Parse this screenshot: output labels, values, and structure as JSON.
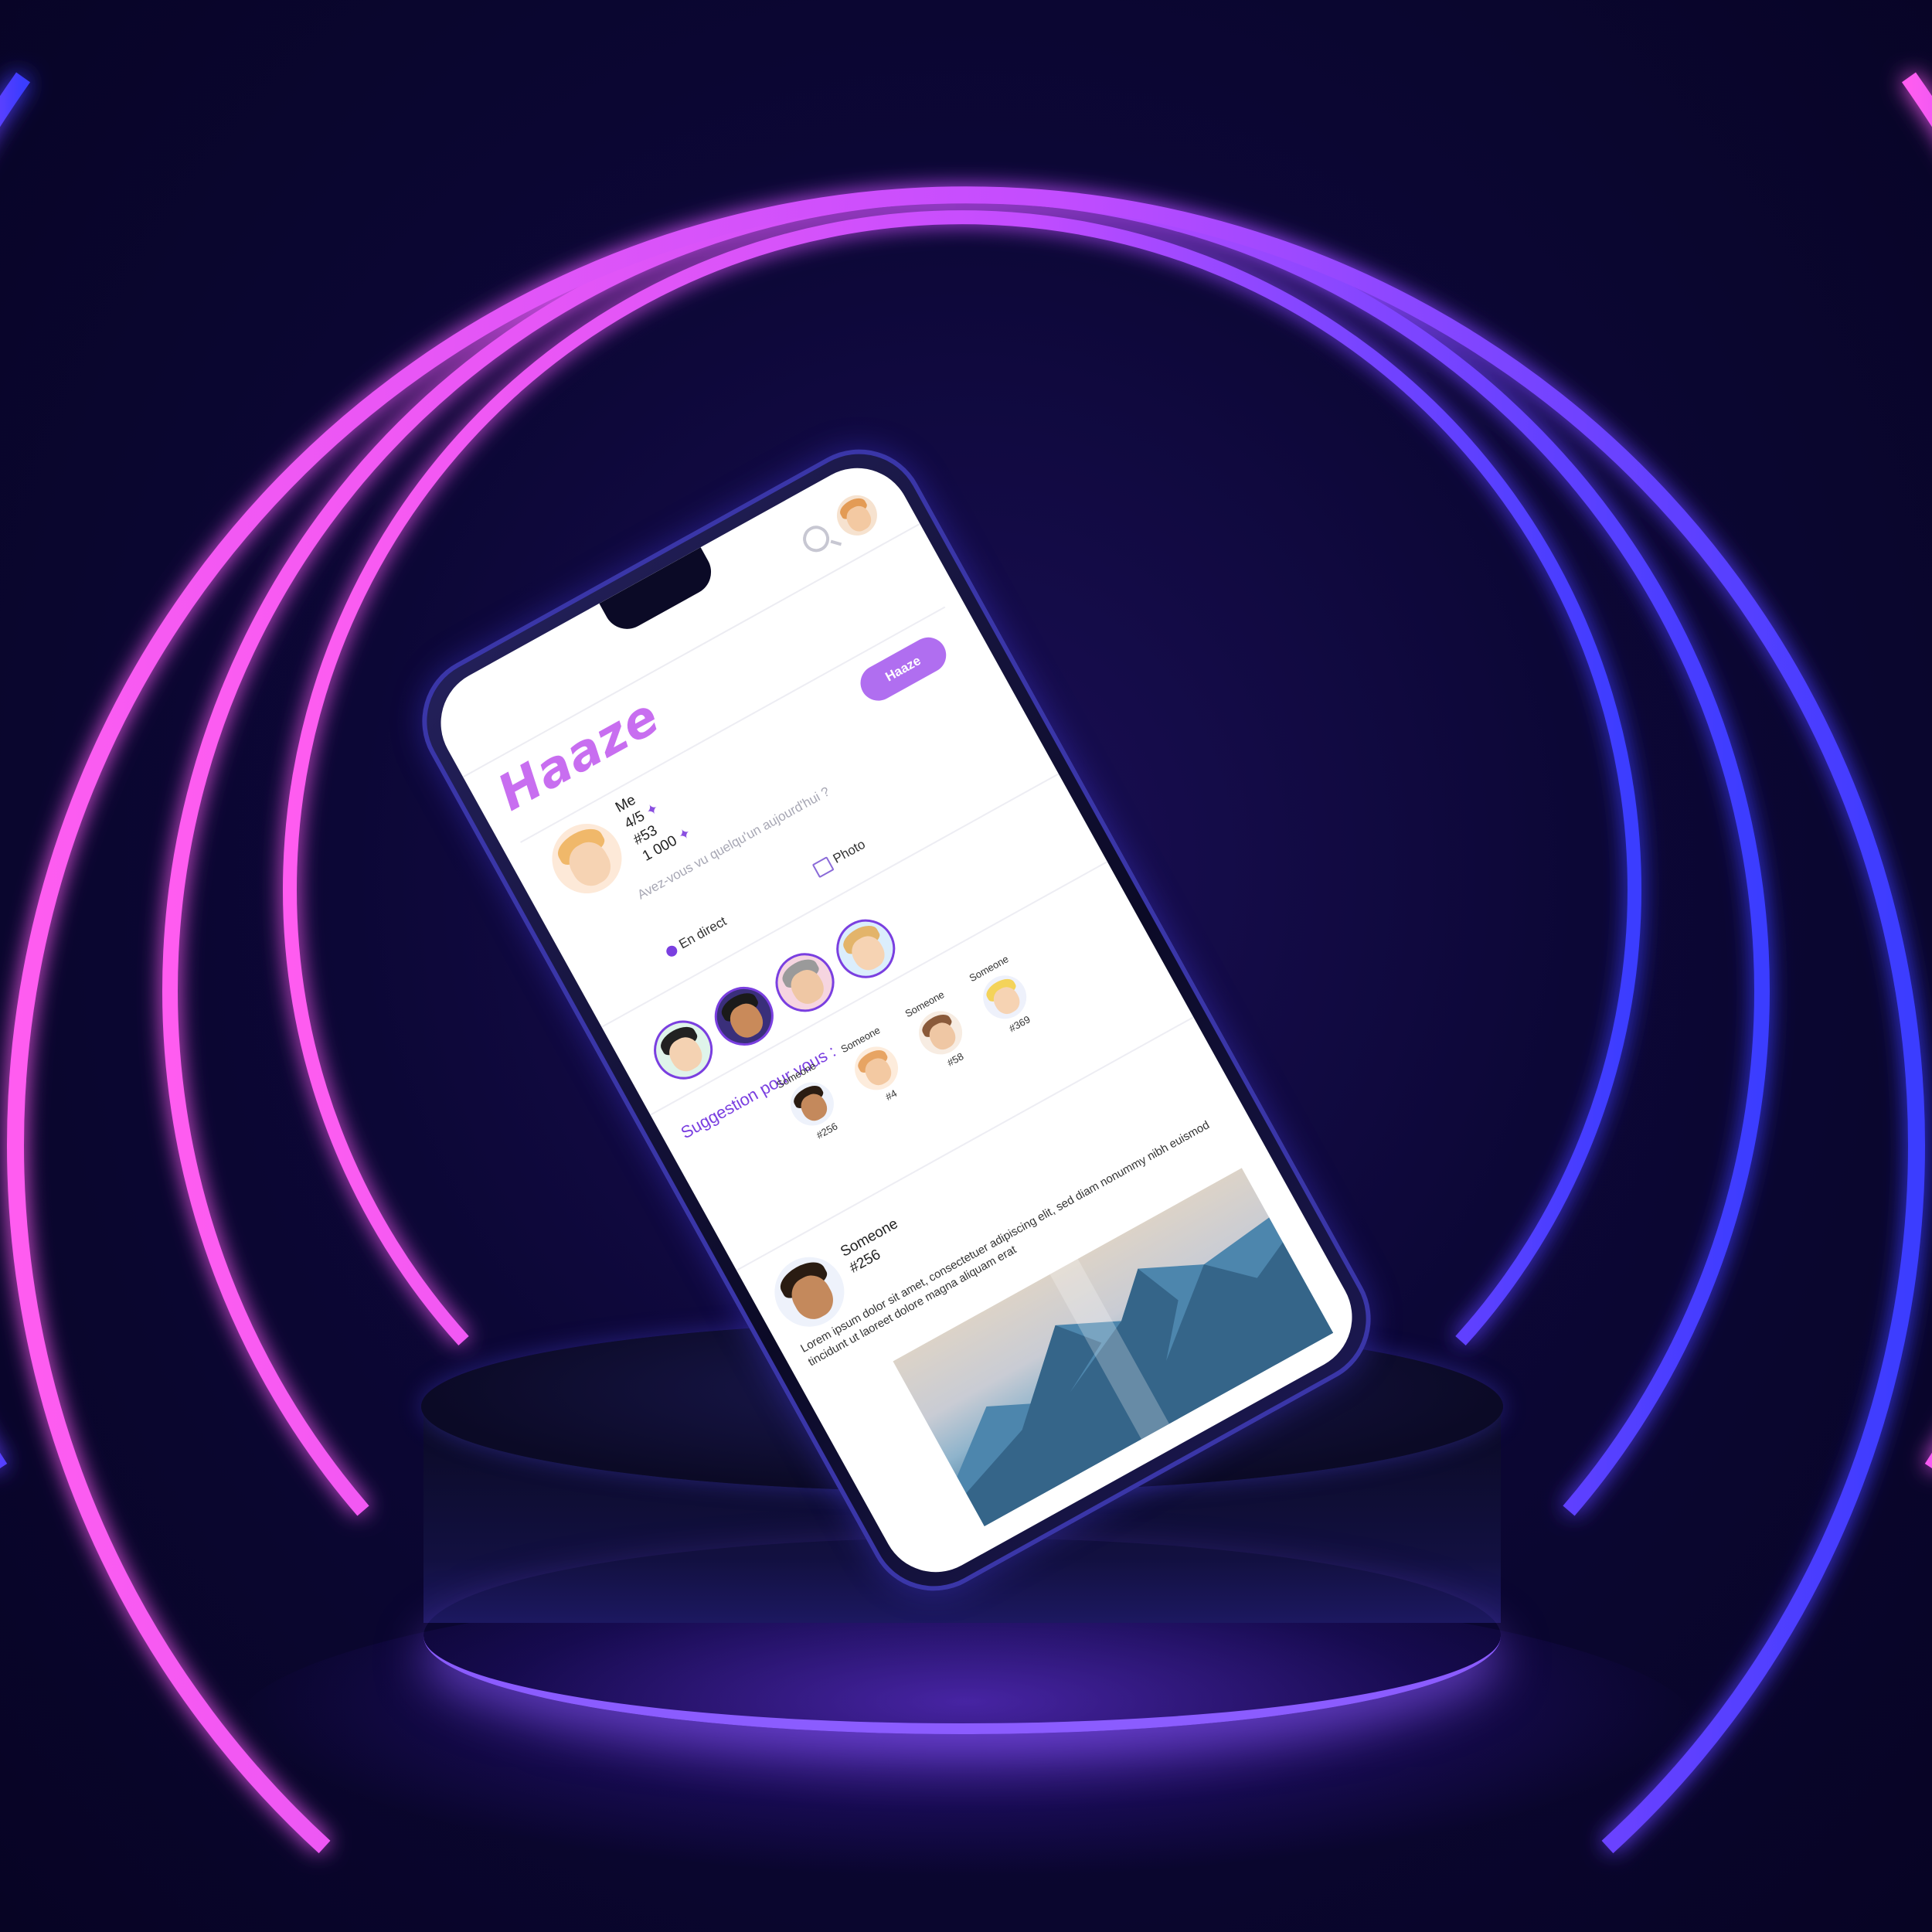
{
  "scene": {
    "ring_colors": [
      "#ff5cf0",
      "#c24dff",
      "#6a4bff",
      "#3a3cff"
    ],
    "background_color": "#0c0736",
    "pedestal_glow_color": "#8b5cff"
  },
  "app": {
    "logo": "Haaze",
    "composer": {
      "user_name": "Me",
      "stat_rating": "4/5",
      "stat_rank": "#53",
      "stat_followers": "1 000",
      "placeholder": "Avez-vous vu quelqu'un aujourd'hui ?",
      "post_button": "Haaze",
      "live_label": "En direct",
      "photo_label": "Photo"
    },
    "suggestions": {
      "title": "Suggestion pour vous :",
      "people": [
        {
          "name": "Someone",
          "rank": "#256"
        },
        {
          "name": "Someone",
          "rank": "#4"
        },
        {
          "name": "Someone",
          "rank": "#58"
        },
        {
          "name": "Someone",
          "rank": "#369"
        }
      ]
    },
    "post": {
      "author_name": "Someone",
      "author_rank": "#256",
      "text": "Lorem ipsum dolor sit amet, consectetuer adipiscing elit, sed diam nonummy nibh euismod tincidunt ut laoreet dolore magna aliquam erat"
    },
    "icons": [
      "search-icon",
      "profile-avatar",
      "live-dot-icon",
      "photo-icon"
    ]
  }
}
